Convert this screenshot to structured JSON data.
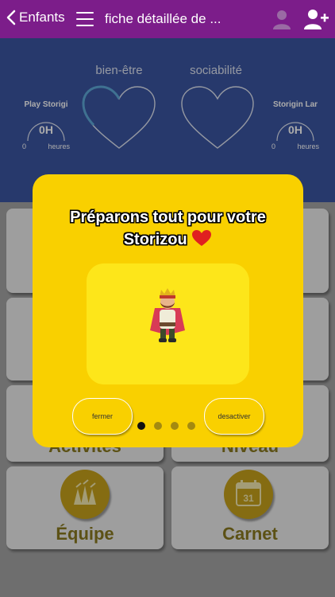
{
  "nav": {
    "back_label": "Enfants",
    "title": "fiche détaillée de ..."
  },
  "stats": {
    "left": {
      "title": "Play Storigi",
      "value": "0H",
      "min": "0",
      "unit": "heures"
    },
    "right": {
      "title": "Storigin Lar",
      "value": "0H",
      "min": "0",
      "unit": "heures"
    },
    "hearts": [
      {
        "label": "bien-être"
      },
      {
        "label": "sociabilité"
      }
    ]
  },
  "tiles": {
    "activities_label": "Activites",
    "level_label": "Niveau",
    "team_label": "Équipe",
    "notebook_label": "Carnet",
    "calendar_day": "31"
  },
  "popup": {
    "title_line1": "Préparons tout pour votre",
    "title_line2": "Storizou",
    "close_label": "fermer",
    "deactivate_label": "desactiver",
    "page_count": 4,
    "active_page": 1
  },
  "colors": {
    "navbar": "#7c1d8a",
    "stats_panel": "#3b55a1",
    "popup": "#f9d000",
    "heart_accent": "#e02020",
    "tile_icon": "#c7a21b"
  }
}
